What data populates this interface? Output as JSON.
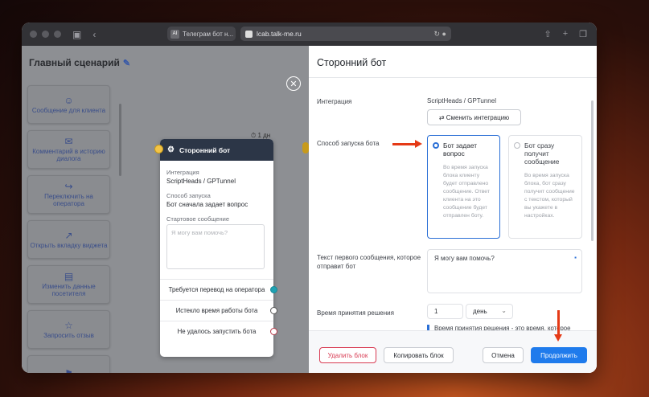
{
  "browser": {
    "tab_favicon": "AI",
    "tab_title": "Телеграм бот н...",
    "url": "lcab.talk-me.ru"
  },
  "canvas": {
    "title": "Главный сценарий",
    "timer": "⏱ 1 дн",
    "palette": [
      {
        "icon": "user-icon",
        "glyph": "☺",
        "label": "Сообщение для клиента"
      },
      {
        "icon": "comment-icon",
        "glyph": "✉",
        "label": "Комментарий в историю диалога"
      },
      {
        "icon": "transfer-icon",
        "glyph": "↪",
        "label": "Переключить на оператора"
      },
      {
        "icon": "open-tab-icon",
        "glyph": "↗",
        "label": "Открыть вкладку виджета"
      },
      {
        "icon": "contact-card-icon",
        "glyph": "▤",
        "label": "Изменить данные посетителя"
      },
      {
        "icon": "star-icon",
        "glyph": "☆",
        "label": "Запросить отзыв"
      },
      {
        "icon": "finish-flag-icon",
        "glyph": "⚑",
        "label": ""
      }
    ]
  },
  "node": {
    "title": "Сторонний бот",
    "integration_label": "Интеграция",
    "integration_value": "ScriptHeads / GPTunnel",
    "method_label": "Способ запуска",
    "method_value": "Бот сначала задает вопрос",
    "start_msg_label": "Стартовое сообщение",
    "start_msg_placeholder": "Я могу вам помочь?",
    "outputs": [
      "Требуется перевод на оператора",
      "Истекло время работы бота",
      "Не удалось запустить бота"
    ]
  },
  "panel": {
    "title": "Сторонний бот",
    "integration_label": "Интеграция",
    "integration_value": "ScriptHeads / GPTunnel",
    "change_integration": "⇄  Сменить интеграцию",
    "launch_label": "Способ запуска бота",
    "options": [
      {
        "title": "Бот задает вопрос",
        "desc": "Во время запуска блока клиенту будет отправлено сообщение. Ответ клиента на это сообщение будет отправлен боту.",
        "selected": true
      },
      {
        "title": "Бот сразу получит сообщение",
        "desc": "Во время запуска блока, бот сразу получит сообщение с текстом, который вы укажете в настройках.",
        "selected": false
      }
    ],
    "first_msg_label": "Текст первого сообщения, которое отправит бот",
    "first_msg_value": "Я могу вам помочь?",
    "decision_label": "Время принятия решения",
    "decision_value": "1",
    "decision_unit": "день",
    "decision_note": "Время принятия решения - это время, которое",
    "buttons": {
      "delete": "Удалить блок",
      "copy": "Копировать блок",
      "cancel": "Отмена",
      "continue": "Продолжить"
    }
  }
}
